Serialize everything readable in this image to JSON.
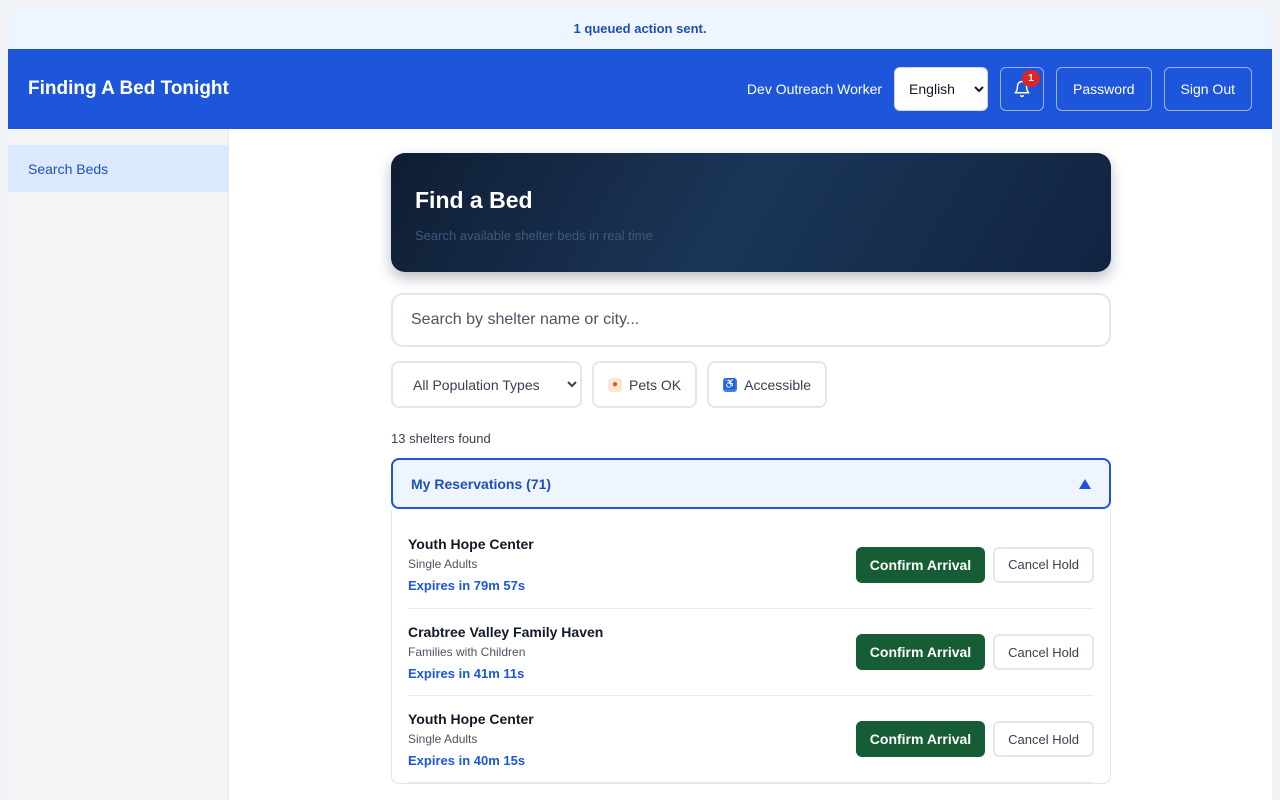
{
  "banner": {
    "text": "1 queued action sent."
  },
  "header": {
    "title": "Finding A Bed Tonight",
    "user": "Dev Outreach Worker",
    "language": "English",
    "notifications": {
      "count": "1"
    },
    "password_label": "Password",
    "signout_label": "Sign Out",
    "bar_color": "#1d56db"
  },
  "sidebar": {
    "items": [
      {
        "label": "Search Beds",
        "active": true
      }
    ]
  },
  "hero": {
    "title": "Find a Bed",
    "subtitle": "Search available shelter beds in real time"
  },
  "search": {
    "placeholder": "Search by shelter name or city..."
  },
  "filters": {
    "population": "All Population Types",
    "pets_label": "Pets OK",
    "pets_icon": "paw-icon",
    "accessible_label": "Accessible",
    "accessible_icon": "wheelchair-icon"
  },
  "results": {
    "count_text": "13 shelters found"
  },
  "reservations": {
    "label": "My Reservations (71)",
    "expanded": true,
    "items": [
      {
        "name": "Youth Hope Center",
        "population": "Single Adults",
        "expires": "Expires in 79m 57s"
      },
      {
        "name": "Crabtree Valley Family Haven",
        "population": "Families with Children",
        "expires": "Expires in 41m 11s"
      },
      {
        "name": "Youth Hope Center",
        "population": "Single Adults",
        "expires": "Expires in 40m 15s"
      }
    ],
    "confirm_label": "Confirm Arrival",
    "cancel_label": "Cancel Hold",
    "confirm_color": "#165c34"
  }
}
